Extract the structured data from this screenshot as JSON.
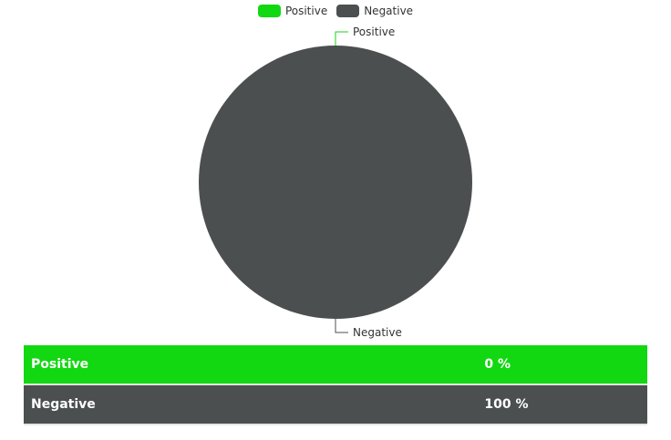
{
  "chart_data": {
    "type": "pie",
    "title": "",
    "categories": [
      "Positive",
      "Negative"
    ],
    "values": [
      0,
      100
    ],
    "colors": [
      "#12d812",
      "#4b4f50"
    ],
    "legend_position": "top-center",
    "slice_labels": [
      "Positive",
      "Negative"
    ]
  },
  "legend": {
    "items": [
      {
        "label": "Positive",
        "color": "#12d812"
      },
      {
        "label": "Negative",
        "color": "#4b4f50"
      }
    ]
  },
  "table": {
    "rows": [
      {
        "label": "Positive",
        "value": "0 %",
        "color": "#12d812"
      },
      {
        "label": "Negative",
        "value": "100 %",
        "color": "#4b4f50"
      }
    ]
  }
}
